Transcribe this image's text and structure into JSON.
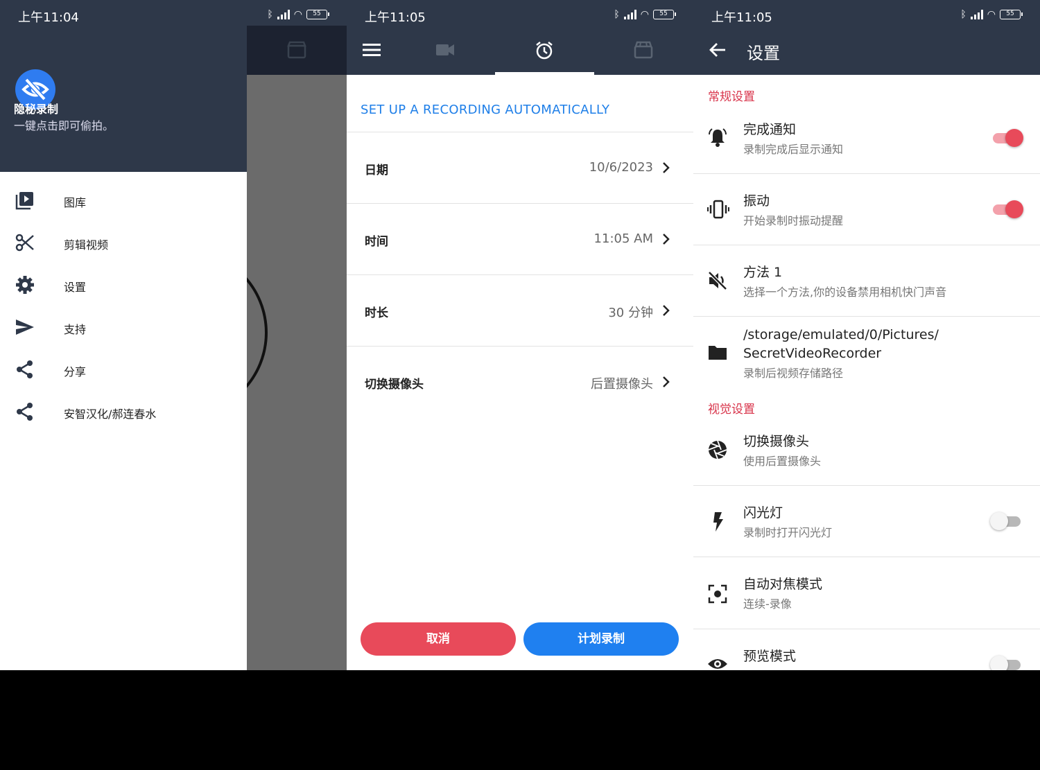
{
  "colors": {
    "header": "#2e3849",
    "accent_blue": "#1f80f0",
    "accent_red": "#e84a5a",
    "section_red": "#d8334a"
  },
  "screen1": {
    "status_time": "上午11:04",
    "battery": "55",
    "app_name": "隐秘录制",
    "app_subtitle": "一键点击即可偷拍。",
    "nav": [
      {
        "label": "图库",
        "icon": "video-library-icon"
      },
      {
        "label": "剪辑视频",
        "icon": "scissors-icon"
      },
      {
        "label": "设置",
        "icon": "gear-icon"
      },
      {
        "label": "支持",
        "icon": "send-icon"
      },
      {
        "label": "分享",
        "icon": "share-icon"
      },
      {
        "label": "安智汉化/郝连春水",
        "icon": "share-icon"
      }
    ]
  },
  "screen2": {
    "status_time": "上午11:05",
    "battery": "55",
    "heading": "SET UP A RECORDING AUTOMATICALLY",
    "rows": [
      {
        "label": "日期",
        "value": "10/6/2023"
      },
      {
        "label": "时间",
        "value": "11:05 AM"
      },
      {
        "label": "时长",
        "value": "30 分钟"
      },
      {
        "label": "切换摄像头",
        "value": "后置摄像头"
      }
    ],
    "cancel_label": "取消",
    "schedule_label": "计划录制"
  },
  "screen3": {
    "status_time": "上午11:05",
    "battery": "55",
    "title": "设置",
    "section_general": "常规设置",
    "section_visual": "视觉设置",
    "notify": {
      "title": "完成通知",
      "subtitle": "录制完成后显示通知",
      "enabled": true
    },
    "vibrate": {
      "title": "振动",
      "subtitle": "开始录制时振动提醒",
      "enabled": true
    },
    "method": {
      "title": "方法 1",
      "subtitle": "选择一个方法,你的设备禁用相机快门声音"
    },
    "path": {
      "line1": "/storage/emulated/0/Pictures/",
      "line2": "SecretVideoRecorder",
      "subtitle": "录制后视频存储路径"
    },
    "camera": {
      "title": "切换摄像头",
      "subtitle": "使用后置摄像头"
    },
    "flash": {
      "title": "闪光灯",
      "subtitle": "录制时打开闪光灯",
      "enabled": false
    },
    "focus": {
      "title": "自动对焦模式",
      "subtitle": "连续-录像"
    },
    "preview": {
      "title": "预览模式",
      "enabled": false
    }
  }
}
